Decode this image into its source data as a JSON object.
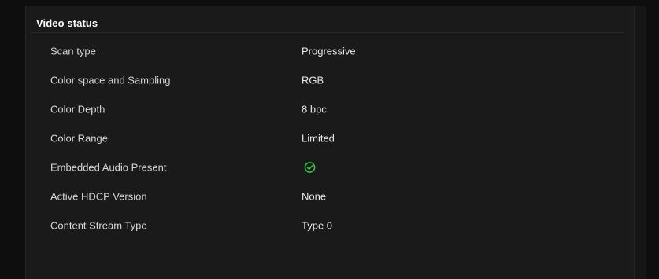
{
  "section": {
    "title": "Video status"
  },
  "rows": [
    {
      "label": "Scan type",
      "value": "Progressive"
    },
    {
      "label": "Color space and Sampling",
      "value": "RGB"
    },
    {
      "label": "Color Depth",
      "value": "8 bpc"
    },
    {
      "label": "Color Range",
      "value": "Limited"
    },
    {
      "label": "Embedded Audio Present",
      "value_icon": "check-circle-icon",
      "value_color": "#2ecc40"
    },
    {
      "label": "Active HDCP Version",
      "value": "None"
    },
    {
      "label": "Content Stream Type",
      "value": "Type 0"
    }
  ]
}
